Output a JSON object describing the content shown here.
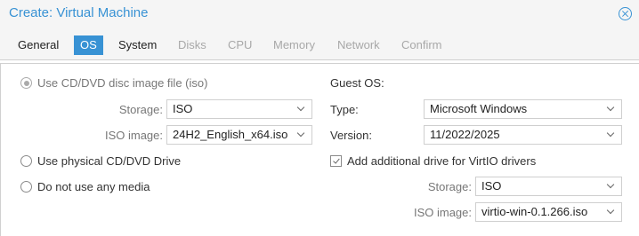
{
  "window": {
    "title": "Create: Virtual Machine",
    "close_icon": "close-circle-icon"
  },
  "tabs": [
    {
      "label": "General",
      "state": "enabled"
    },
    {
      "label": "OS",
      "state": "active"
    },
    {
      "label": "System",
      "state": "enabled"
    },
    {
      "label": "Disks",
      "state": "disabled"
    },
    {
      "label": "CPU",
      "state": "disabled"
    },
    {
      "label": "Memory",
      "state": "disabled"
    },
    {
      "label": "Network",
      "state": "disabled"
    },
    {
      "label": "Confirm",
      "state": "disabled"
    }
  ],
  "media": {
    "option_iso": {
      "label": "Use CD/DVD disc image file (iso)",
      "selected": true
    },
    "storage": {
      "label": "Storage:",
      "value": "ISO"
    },
    "iso_image": {
      "label": "ISO image:",
      "value": "24H2_English_x64.iso"
    },
    "option_physical": {
      "label": "Use physical CD/DVD Drive",
      "selected": false
    },
    "option_none": {
      "label": "Do not use any media",
      "selected": false
    }
  },
  "guest_os": {
    "heading": "Guest OS:",
    "type": {
      "label": "Type:",
      "value": "Microsoft Windows"
    },
    "version": {
      "label": "Version:",
      "value": "11/2022/2025"
    },
    "virtio_drive": {
      "label": "Add additional drive for VirtIO drivers",
      "checked": true
    },
    "storage": {
      "label": "Storage:",
      "value": "ISO"
    },
    "iso_image": {
      "label": "ISO image:",
      "value": "virtio-win-0.1.266.iso"
    }
  },
  "colors": {
    "accent": "#3892d4",
    "active_tab_text": "#ffffff",
    "disabled_text": "#a8a8a8"
  }
}
